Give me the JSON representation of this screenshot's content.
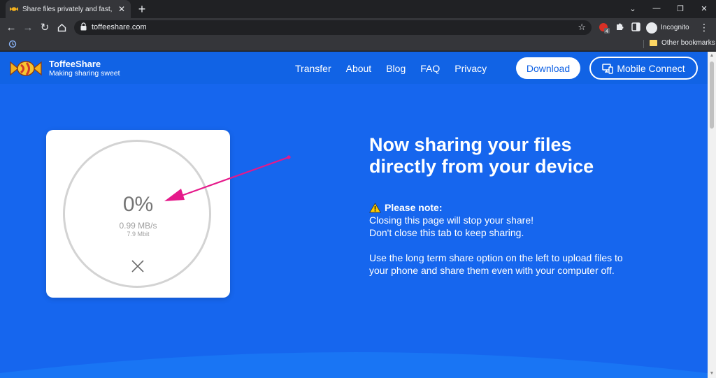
{
  "browser": {
    "tab_title": "Share files privately and fast, wit",
    "url": "toffeeshare.com",
    "incognito_label": "Incognito",
    "other_bookmarks": "Other bookmarks",
    "extension_badge": "4"
  },
  "site": {
    "brand": "ToffeeShare",
    "tagline": "Making sharing sweet",
    "nav": [
      "Transfer",
      "About",
      "Blog",
      "FAQ",
      "Privacy"
    ],
    "download_label": "Download",
    "mobile_label": "Mobile Connect"
  },
  "transfer": {
    "percent": "0%",
    "speed": "0.99 MB/s",
    "speed_mbit": "7.9 Mbit"
  },
  "info": {
    "headline_line1": "Now sharing your files",
    "headline_line2": "directly from your device",
    "note_title": "Please note:",
    "note_line1": "Closing this page will stop your share!",
    "note_line2": "Don't close this tab to keep sharing.",
    "long_term_text": "Use the long term share option on the left to upload files to your phone and share them even with your computer off."
  },
  "colors": {
    "page_bg": "#1666ee",
    "accent_arrow": "#e5198a"
  }
}
